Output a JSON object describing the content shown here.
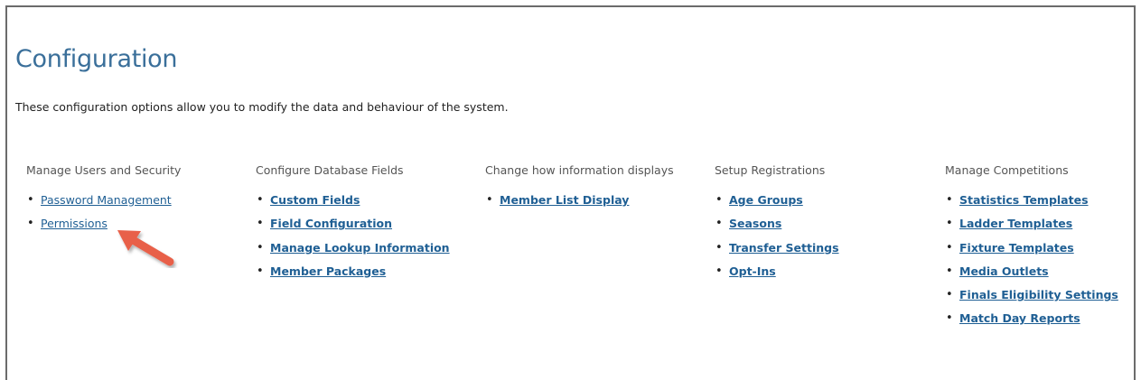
{
  "page": {
    "title": "Configuration",
    "intro": "These configuration options allow you to modify the data and behaviour of the system."
  },
  "columns": [
    {
      "heading": "Manage Users and Security",
      "links": [
        "Password Management",
        "Permissions"
      ]
    },
    {
      "heading": "Configure Database Fields",
      "links": [
        "Custom Fields",
        "Field Configuration",
        "Manage Lookup Information",
        "Member Packages"
      ]
    },
    {
      "heading": "Change how information displays",
      "links": [
        "Member List Display"
      ]
    },
    {
      "heading": "Setup Registrations",
      "links": [
        "Age Groups",
        "Seasons",
        "Transfer Settings",
        "Opt-Ins"
      ]
    },
    {
      "heading": "Manage Competitions",
      "links": [
        "Statistics Templates",
        "Ladder Templates",
        "Fixture Templates",
        "Media Outlets",
        "Finals Eligibility Settings",
        "Match Day Reports"
      ]
    }
  ],
  "bullet": "•",
  "colors": {
    "title": "#3a6f9a",
    "link": "#1f5f94",
    "annotation_arrow": "#e8604a"
  },
  "annotation": {
    "icon": "pointer-arrow-icon",
    "target": "Permissions"
  }
}
